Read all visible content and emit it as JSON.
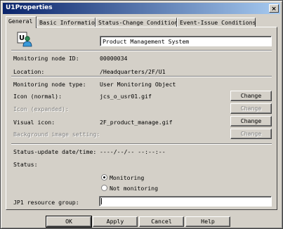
{
  "window": {
    "title": "U1Properties",
    "close_glyph": "×"
  },
  "tabs": [
    {
      "label": "General",
      "active": true
    },
    {
      "label": "Basic Information",
      "active": false
    },
    {
      "label": "Status-Change Condition",
      "active": false
    },
    {
      "label": "Event-Issue Conditions",
      "active": false
    }
  ],
  "general": {
    "icon": "user-monitoring-object-icon",
    "name_value": "Product Management System",
    "node_id_label": "Monitoring node ID:",
    "node_id_value": "00000034",
    "location_label": "Location:",
    "location_value": "/Headquarters/2F/U1",
    "node_type_label": "Monitoring node type:",
    "node_type_value": "User Monitoring Object",
    "icon_normal_label": "Icon (normal):",
    "icon_normal_value": "jcs_o_usr01.gif",
    "icon_expanded_label": "Icon (expanded):",
    "visual_icon_label": "Visual icon:",
    "visual_icon_value": "2F_product_manage.gif",
    "background_label": "Background image setting:",
    "change_label": "Change",
    "status_update_label": "Status-update date/time:",
    "status_update_value": "----/--/-- --:--:--",
    "status_label": "Status:",
    "radio_monitoring": "Monitoring",
    "radio_not_monitoring": "Not monitoring",
    "monitoring_selected": true,
    "jp1_group_label": "JP1 resource group:",
    "jp1_group_value": ""
  },
  "footer": {
    "ok": "OK",
    "apply": "Apply",
    "cancel": "Cancel",
    "help": "Help"
  }
}
